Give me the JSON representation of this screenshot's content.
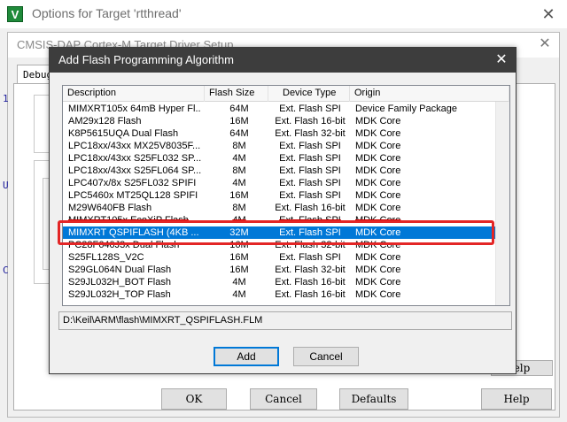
{
  "options_window": {
    "title": "Options for Target 'rtthread'",
    "close_glyph": "✕"
  },
  "driver_window": {
    "title": "CMSIS-DAP Cortex-M Target Driver Setup",
    "close_glyph": "✕",
    "tab_debug": "Debug",
    "left_glyphs": [
      "1",
      "U",
      "C"
    ],
    "bottom_buttons": {
      "ok": "OK",
      "cancel": "Cancel",
      "defaults": "Defaults",
      "help": "Help"
    },
    "partial_help": "elp"
  },
  "dialog": {
    "title": "Add Flash Programming Algorithm",
    "close_glyph": "✕",
    "columns": [
      "Description",
      "Flash Size",
      "Device Type",
      "Origin"
    ],
    "rows": [
      [
        "MIMXRT105x 64mB Hyper Fl...",
        "64M",
        "Ext. Flash SPI",
        "Device Family Package"
      ],
      [
        "AM29x128 Flash",
        "16M",
        "Ext. Flash 16-bit",
        "MDK Core"
      ],
      [
        "K8P5615UQA Dual Flash",
        "64M",
        "Ext. Flash 32-bit",
        "MDK Core"
      ],
      [
        "LPC18xx/43xx MX25V8035F...",
        "8M",
        "Ext. Flash SPI",
        "MDK Core"
      ],
      [
        "LPC18xx/43xx S25FL032 SP...",
        "4M",
        "Ext. Flash SPI",
        "MDK Core"
      ],
      [
        "LPC18xx/43xx S25FL064 SP...",
        "8M",
        "Ext. Flash SPI",
        "MDK Core"
      ],
      [
        "LPC407x/8x S25FL032 SPIFI",
        "4M",
        "Ext. Flash SPI",
        "MDK Core"
      ],
      [
        "LPC5460x MT25QL128 SPIFI",
        "16M",
        "Ext. Flash SPI",
        "MDK Core"
      ],
      [
        "M29W640FB Flash",
        "8M",
        "Ext. Flash 16-bit",
        "MDK Core"
      ],
      [
        "MIMXRT105x EcoXiP Flash",
        "4M",
        "Ext. Flash SPI",
        "MDK Core"
      ],
      [
        "MIMXRT QSPIFLASH (4KB ...",
        "32M",
        "Ext. Flash SPI",
        "MDK Core"
      ],
      [
        "PC28F640J3x Dual Flash",
        "16M",
        "Ext. Flash 32-bit",
        "MDK Core"
      ],
      [
        "S25FL128S_V2C",
        "16M",
        "Ext. Flash SPI",
        "MDK Core"
      ],
      [
        "S29GL064N Dual Flash",
        "16M",
        "Ext. Flash 32-bit",
        "MDK Core"
      ],
      [
        "S29JL032H_BOT Flash",
        "4M",
        "Ext. Flash 16-bit",
        "MDK Core"
      ],
      [
        "S29JL032H_TOP Flash",
        "4M",
        "Ext. Flash 16-bit",
        "MDK Core"
      ]
    ],
    "selected_index": 10,
    "path": "D:\\Keil\\ARM\\flash\\MIMXRT_QSPIFLASH.FLM",
    "add_label": "Add",
    "cancel_label": "Cancel"
  },
  "colors": {
    "selection": "#0078d7",
    "annotation": "#e32626",
    "dialog_titlebar": "#3d3d3d"
  }
}
